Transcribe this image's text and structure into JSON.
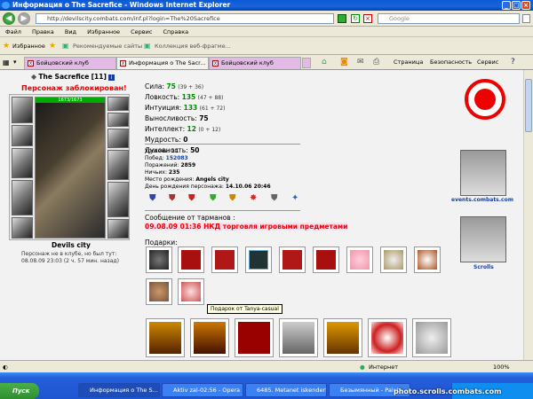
{
  "window": {
    "title": "Информация о The Sacrefice - Windows Internet Explorer"
  },
  "address": {
    "url": "http://devilscity.combats.com/inf.pl?login=The%20Sacrefice",
    "search_placeholder": "Google"
  },
  "menu": [
    "Файл",
    "Правка",
    "Вид",
    "Избранное",
    "Сервис",
    "Справка"
  ],
  "favorites": {
    "fav_label": "Избранное",
    "suggested": "Рекомендуемые сайты",
    "gallery": "Коллекция веб-фрагме..."
  },
  "tabs": [
    {
      "label": "Бойцовский клуб"
    },
    {
      "label": "Информация о The Sacr..."
    },
    {
      "label": "Бойцовский клуб"
    }
  ],
  "toolbar": {
    "page": "Страница",
    "security": "Безопасность",
    "tools": "Сервис"
  },
  "character": {
    "name": "The Sacrefice",
    "level": "[11]",
    "blocked": "Персонаж заблокирован!",
    "hp": "1673/1673",
    "city": "Devils city",
    "status_line1": "Персонаж не в клубе, но был тут:",
    "status_line2": "08.08.09 23:03 (2 ч. 57 мин. назад)"
  },
  "stats": [
    {
      "label": "Сила:",
      "value": "75",
      "extra": "(39 + 36)",
      "green": true
    },
    {
      "label": "Ловкость:",
      "value": "135",
      "extra": "(47 + 88)",
      "green": true
    },
    {
      "label": "Интуиция:",
      "value": "133",
      "extra": "(61 + 72)",
      "green": true
    },
    {
      "label": "Выносливость:",
      "value": "75",
      "extra": "",
      "green": false
    },
    {
      "label": "Интеллект:",
      "value": "12",
      "extra": "(0 + 12)",
      "green": true
    },
    {
      "label": "Мудрость:",
      "value": "0",
      "extra": "",
      "green": false
    },
    {
      "label": "Духовность:",
      "value": "50",
      "extra": "",
      "green": false
    }
  ],
  "info": [
    {
      "label": "Уровень:",
      "value": "11"
    },
    {
      "label": "Побед:",
      "value": "152083"
    },
    {
      "label": "Поражений:",
      "value": "2859"
    },
    {
      "label": "Ничьих:",
      "value": "235"
    },
    {
      "label": "Место рождения:",
      "value": "Angels city"
    },
    {
      "label": "День рождения персонажа:",
      "value": "14.10.06 20:46"
    }
  ],
  "message": {
    "heading": "Сообщение от тарманов :",
    "text": "09.08.09 01:36 НКД торговля игровыми предметами"
  },
  "gifts": {
    "heading": "Подарки:",
    "tooltip": "Подарок от Tanya-casual"
  },
  "right_panel": {
    "link1": "events.combats.com",
    "link2": "Scrolls"
  },
  "status": {
    "text": "Интернет",
    "zoom": "100%"
  },
  "taskbar": {
    "start": "Пуск",
    "items": [
      "Информация о The S...",
      "Aktiv zal-02:56 - Opera",
      "6485. Metanet iskenderli...",
      "Безымянный - Paint"
    ],
    "watermark": "photo.scrolls.combats.com"
  },
  "colors": {
    "accent": "#e00000",
    "green": "#008800",
    "blue": "#1a3f9a"
  }
}
